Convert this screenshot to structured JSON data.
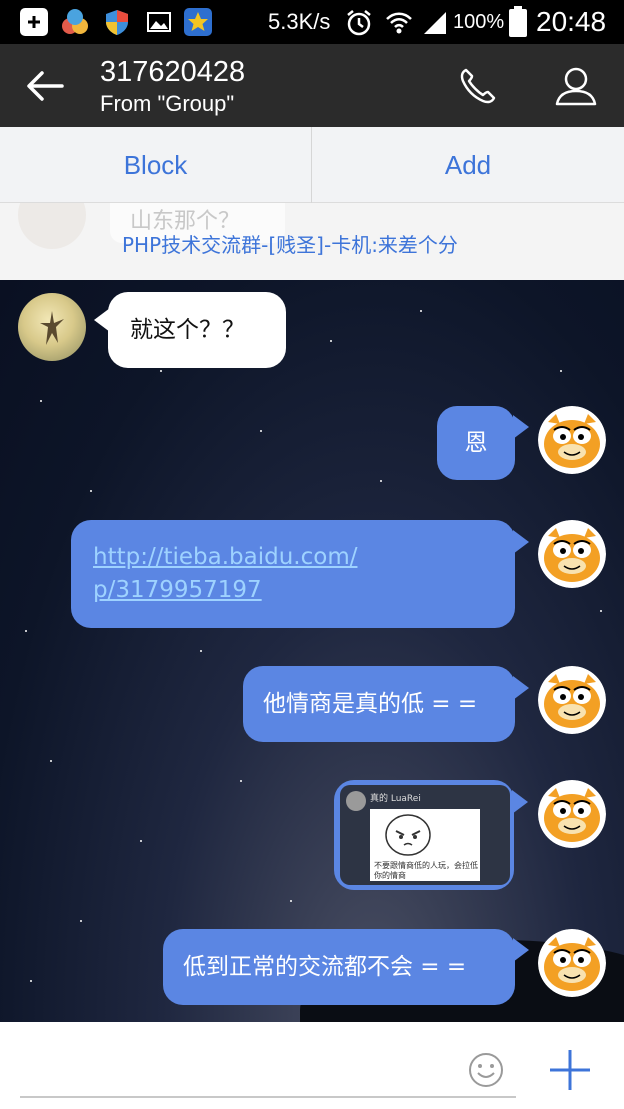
{
  "status_bar": {
    "network_speed": "5.3K/s",
    "battery": "100%",
    "time": "20:48"
  },
  "header": {
    "title": "317620428",
    "subtitle": "From \"Group\""
  },
  "actions": {
    "block": "Block",
    "add": "Add"
  },
  "notice": {
    "ghost_text": "山东那个？",
    "text": "PHP技术交流群-[贱圣]-卡机:来差个分"
  },
  "messages": [
    {
      "direction": "in",
      "type": "text",
      "text": "就这个？？"
    },
    {
      "direction": "out",
      "type": "text",
      "text": "恩"
    },
    {
      "direction": "out",
      "type": "link",
      "text_line1": "http://tieba.baidu.com/",
      "text_line2": "p/3179957197"
    },
    {
      "direction": "out",
      "type": "text",
      "text": "他情商是真的低 = ="
    },
    {
      "direction": "out",
      "type": "image",
      "image_name": "真的 LuaRei",
      "image_caption": "不要跟情商低的人玩，会拉低你的情商"
    },
    {
      "direction": "out",
      "type": "text",
      "text": "低到正常的交流都不会 = ="
    }
  ],
  "icons": {
    "back": "arrow-left-icon",
    "call": "phone-icon",
    "profile": "person-icon",
    "emoji": "smiley-icon",
    "more": "plus-icon"
  },
  "colors": {
    "accent": "#3d74d9",
    "outgoing_bubble": "#5b86e3",
    "incoming_bubble": "#ffffff",
    "header_bg": "#2b2b2b"
  }
}
